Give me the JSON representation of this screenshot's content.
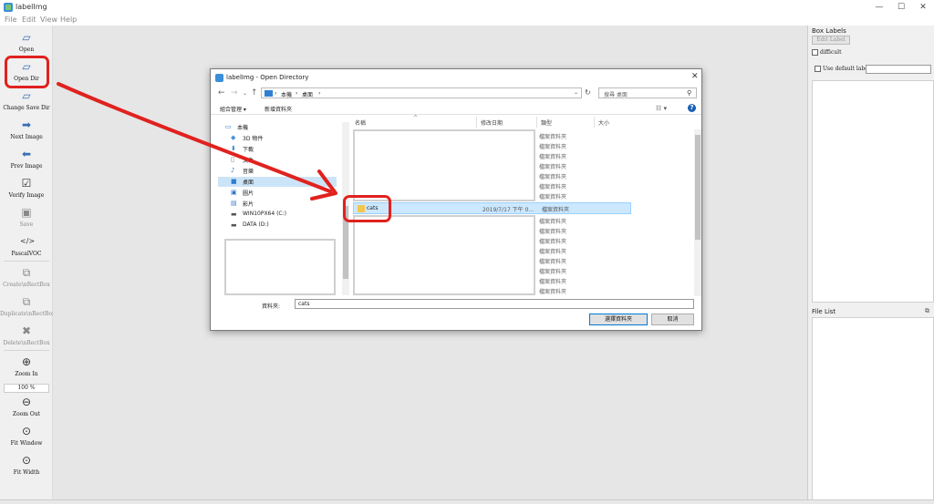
{
  "app": {
    "title": "labelImg",
    "window_controls": [
      "—",
      "☐",
      "✕"
    ]
  },
  "menu": [
    "File",
    "Edit",
    "View",
    "Help"
  ],
  "toolbar": {
    "open": "Open",
    "open_dir": "Open Dir",
    "change_save_dir": "Change Save Dir",
    "next_image": "Next Image",
    "prev_image": "Prev Image",
    "verify_image": "Verify Image",
    "save": "Save",
    "format": "PascalVOC",
    "create_rectbox": "Create\\nRectBox",
    "duplicate_rectbox": "Duplicate\\nRectBox",
    "delete_rectbox": "Delete\\nRectBox",
    "zoom_in": "Zoom In",
    "zoom_value": "100 %",
    "zoom_out": "Zoom Out",
    "fit_window": "Fit Window",
    "fit_width": "Fit Width"
  },
  "dock": {
    "box_labels_title": "Box Labels",
    "edit_label": "Edit Label",
    "difficult": "difficult",
    "use_default_label": "Use default label",
    "file_list_title": "File List"
  },
  "dialog": {
    "title": "labelImg - Open Directory",
    "breadcrumb": [
      "本機",
      "桌面"
    ],
    "search_placeholder": "搜尋 桌面",
    "organize": "組合管理 ▾",
    "new_folder": "新增資料夾",
    "nav_items": [
      {
        "icon": "computer-icon",
        "label": "本機"
      },
      {
        "icon": "3d-objects-icon",
        "label": "3D 物件"
      },
      {
        "icon": "downloads-icon",
        "label": "下載"
      },
      {
        "icon": "documents-icon",
        "label": "文件"
      },
      {
        "icon": "music-icon",
        "label": "音樂"
      },
      {
        "icon": "desktop-icon",
        "label": "桌面"
      },
      {
        "icon": "pictures-icon",
        "label": "圖片"
      },
      {
        "icon": "videos-icon",
        "label": "影片"
      },
      {
        "icon": "drive-c-icon",
        "label": "WIN10PX64 (C:)"
      },
      {
        "icon": "drive-d-icon",
        "label": "DATA (D:)"
      }
    ],
    "columns": [
      "名稱",
      "修改日期",
      "類型",
      "大小"
    ],
    "folder_type": "檔案資料夾",
    "selected_row": {
      "name": "cats",
      "date": "2019/7/17 下午 0...",
      "type": "檔案資料夾"
    },
    "folder_label": "資料夾:",
    "folder_value": "cats",
    "select_button": "選擇資料夾",
    "cancel_button": "取消"
  },
  "colors": {
    "annotation_red": "#e0221f",
    "selection_blue": "#cce8ff",
    "primary_border": "#0078d7"
  }
}
